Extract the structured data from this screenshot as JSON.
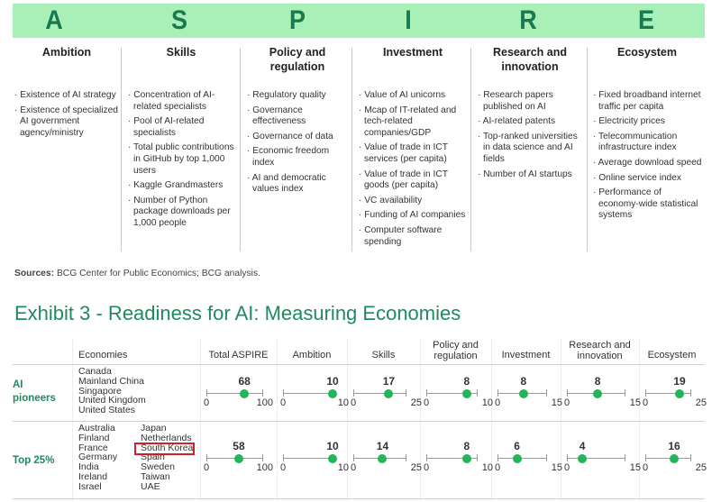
{
  "banner": {
    "letters": [
      "A",
      "S",
      "P",
      "I",
      "R",
      "E"
    ],
    "bg_color": "#a8efb8",
    "letter_color": "#1a7a4e"
  },
  "pillars": [
    {
      "title": "Ambition",
      "items": [
        "Existence of AI strategy",
        "Existence of specialized AI government agency/ministry"
      ]
    },
    {
      "title": "Skills",
      "items": [
        "Concentration of AI-related specialists",
        "Pool of AI-related specialists",
        "Total public contributions in GitHub by top 1,000 users",
        "Kaggle Grandmasters",
        "Number of Python package downloads per 1,000 people"
      ]
    },
    {
      "title": "Policy and regulation",
      "items": [
        "Regulatory quality",
        "Governance effectiveness",
        "Governance of data",
        "Economic freedom index",
        "AI and democratic values index"
      ]
    },
    {
      "title": "Investment",
      "items": [
        "Value of AI unicorns",
        "Mcap of IT-related and tech-related companies/GDP",
        "Value of trade in ICT services (per capita)",
        "Value of trade in ICT goods (per capita)",
        "VC availability",
        "Funding of AI companies",
        "Computer software spending"
      ]
    },
    {
      "title": "Research and innovation",
      "items": [
        "Research papers published on AI",
        "AI-related patents",
        "Top-ranked universities in data science and AI fields",
        "Number of AI startups"
      ]
    },
    {
      "title": "Ecosystem",
      "items": [
        "Fixed broadband internet traffic per capita",
        "Electricity prices",
        "Telecommunication infrastructure index",
        "Average download speed",
        "Online service index",
        "Performance of economy-wide statistical systems"
      ]
    }
  ],
  "sources": {
    "label": "Sources:",
    "text": " BCG Center for Public Economics; BCG analysis."
  },
  "exhibit": {
    "title": "Exhibit 3 - Readiness for AI: Measuring Economies",
    "headers": [
      "Economies",
      "Total ASPIRE",
      "Ambition",
      "Skills",
      "Policy and regulation",
      "Investment",
      "Research and innovation",
      "Ecosystem"
    ],
    "scales": [
      [
        0,
        100
      ],
      [
        0,
        10
      ],
      [
        0,
        25
      ],
      [
        0,
        10
      ],
      [
        0,
        15
      ],
      [
        0,
        15
      ],
      [
        0,
        25
      ]
    ],
    "highlight": "South Korea",
    "highlight_color": "#d0202a",
    "dot_color": "#22b55a",
    "rows": [
      {
        "label": "AI pioneers",
        "economies_col1": [
          "Canada",
          "Mainland China",
          "Singapore",
          "United Kingdom",
          "United States"
        ],
        "economies_col2": [],
        "values": [
          68,
          10,
          17,
          8,
          8,
          8,
          19
        ]
      },
      {
        "label": "Top 25%",
        "economies_col1": [
          "Australia",
          "Finland",
          "France",
          "Germany",
          "India",
          "Ireland",
          "Israel"
        ],
        "economies_col2": [
          "Japan",
          "Netherlands",
          "South Korea",
          "Spain",
          "Sweden",
          "Taiwan",
          "UAE"
        ],
        "values": [
          58,
          10,
          14,
          8,
          6,
          4,
          16
        ]
      }
    ]
  }
}
